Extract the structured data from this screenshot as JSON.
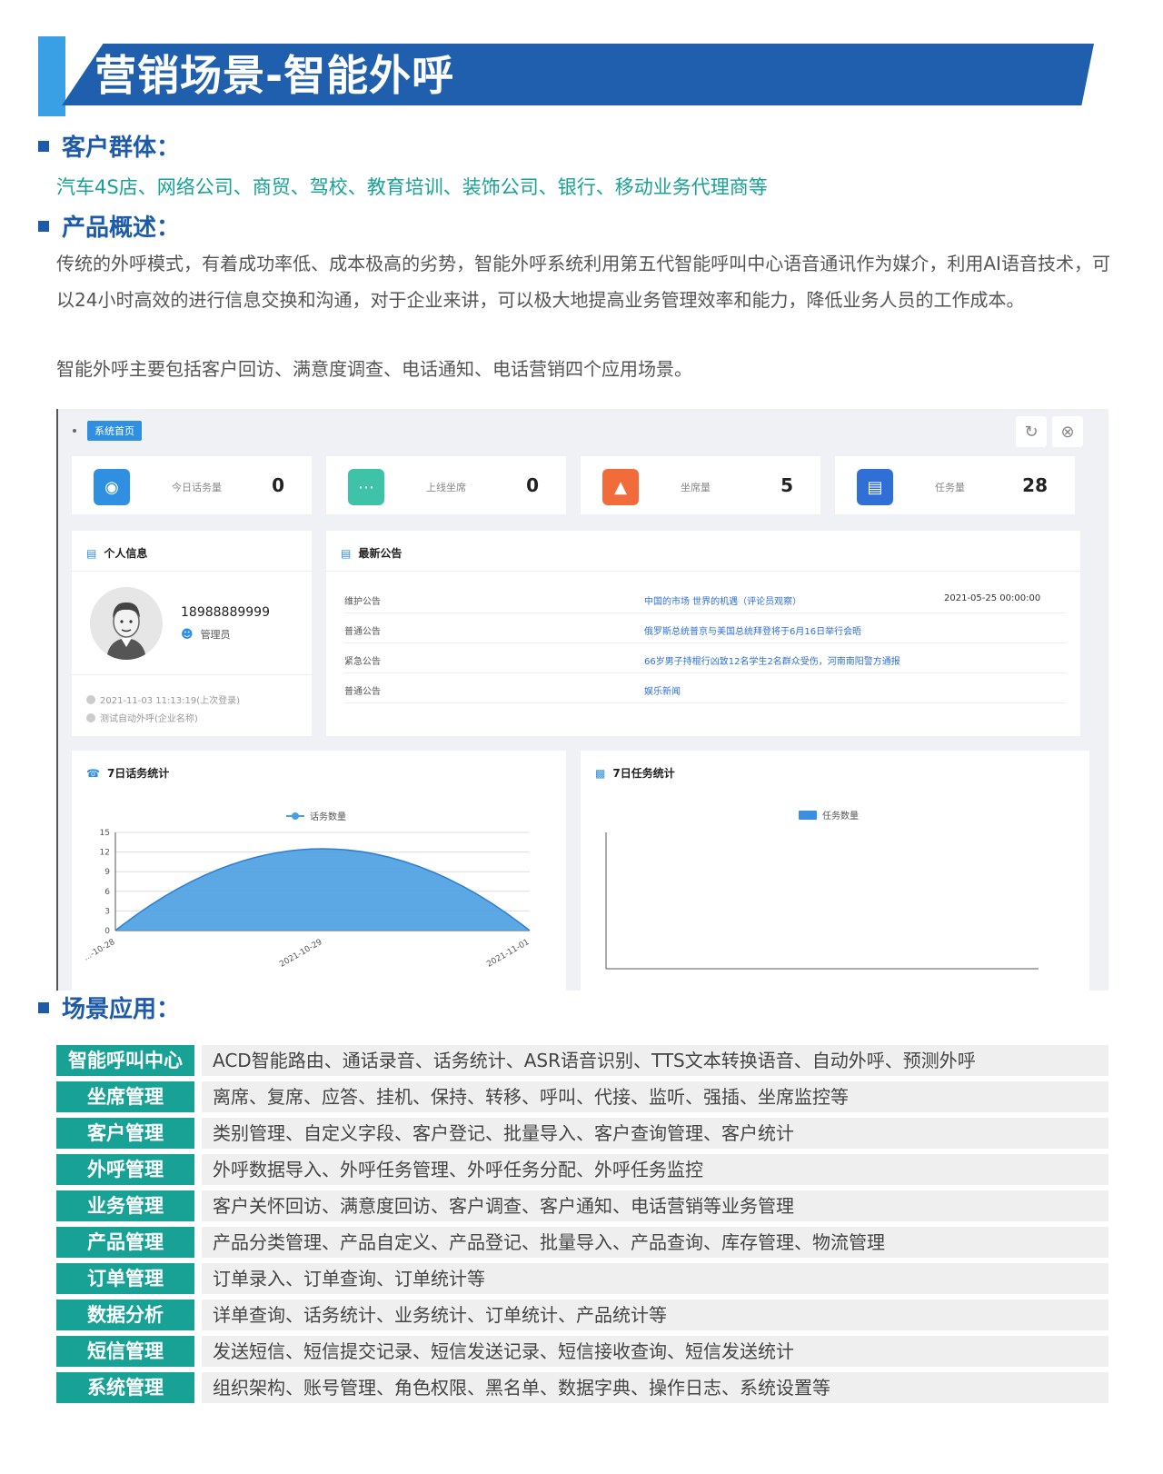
{
  "banner": {
    "title": "营销场景-智能外呼"
  },
  "customers": {
    "heading": "客户群体：",
    "text": "汽车4S店、网络公司、商贸、驾校、教育培训、装饰公司、银行、移动业务代理商等"
  },
  "overview": {
    "heading": "产品概述：",
    "paragraph1": "传统的外呼模式，有着成功率低、成本极高的劣势，智能外呼系统利用第五代智能呼叫中心语音通讯作为媒介，利用AI语音技术，可以24小时高效的进行信息交换和沟通，对于企业来讲，可以极大地提高业务管理效率和能力，降低业务人员的工作成本。",
    "paragraph2": "智能外呼主要包括客户回访、满意度调查、电话通知、电话营销四个应用场景。"
  },
  "dashboard": {
    "tab_label": "系统首页",
    "stats": [
      {
        "label": "今日话务量",
        "value": "0",
        "color": "#2f8fe0",
        "icon": "eye-icon"
      },
      {
        "label": "上线坐席",
        "value": "0",
        "color": "#3fc3a8",
        "icon": "chat-icon"
      },
      {
        "label": "坐席量",
        "value": "5",
        "color": "#f26b3a",
        "icon": "chart-icon"
      },
      {
        "label": "任务量",
        "value": "28",
        "color": "#2f6fd6",
        "icon": "clipboard-icon"
      }
    ],
    "profile": {
      "title": "个人信息",
      "phone": "18988889999",
      "role": "管理员",
      "last_login": "2021-11-03 11:13:19(上次登录)",
      "company": "测试自动外呼(企业名称)"
    },
    "notices": {
      "title": "最新公告",
      "rows": [
        {
          "type": "维护公告",
          "text": "中国的市场 世界的机遇（评论员观察）",
          "date": "2021-05-25 00:00:00"
        },
        {
          "type": "普通公告",
          "text": "俄罗斯总统普京与美国总统拜登将于6月16日举行会晤",
          "date": ""
        },
        {
          "type": "紧急公告",
          "text": "66岁男子持棍行凶致12名学生2名群众受伤，河南南阳警方通报",
          "date": ""
        },
        {
          "type": "普通公告",
          "text": "娱乐新闻",
          "date": ""
        }
      ]
    },
    "call_chart_title": "7日话务统计",
    "task_chart_title": "7日任务统计"
  },
  "chart_data": [
    {
      "type": "area",
      "title": "7日话务统计",
      "series": [
        {
          "name": "话务数量",
          "x": [
            "2021-10-28",
            "2021-10-29",
            "2021-11-01"
          ],
          "values": [
            0,
            12.5,
            0
          ]
        }
      ],
      "x_tick_labels": [
        "...-10-28",
        "2021-10-29",
        "2021-11-01"
      ],
      "y_ticks": [
        0,
        3,
        6,
        9,
        12,
        15
      ],
      "ylim": [
        0,
        15
      ],
      "grid": true,
      "legend": "top-center",
      "color": "#4a9fe2"
    },
    {
      "type": "bar",
      "title": "7日任务统计",
      "series": [
        {
          "name": "任务数量",
          "values": []
        }
      ],
      "legend": "top-center",
      "color": "#3a8fe0"
    }
  ],
  "scenes": {
    "heading": "场景应用：",
    "rows": [
      {
        "name": "智能呼叫中心",
        "desc": "ACD智能路由、通话录音、话务统计、ASR语音识别、TTS文本转换语音、自动外呼、预测外呼"
      },
      {
        "name": "坐席管理",
        "desc": "离席、复席、应答、挂机、保持、转移、呼叫、代接、监听、强插、坐席监控等"
      },
      {
        "name": "客户管理",
        "desc": "类别管理、自定义字段、客户登记、批量导入、客户查询管理、客户统计"
      },
      {
        "name": "外呼管理",
        "desc": "外呼数据导入、外呼任务管理、外呼任务分配、外呼任务监控"
      },
      {
        "name": "业务管理",
        "desc": "客户关怀回访、满意度回访、客户调查、客户通知、电话营销等业务管理"
      },
      {
        "name": "产品管理",
        "desc": "产品分类管理、产品自定义、产品登记、批量导入、产品查询、库存管理、物流管理"
      },
      {
        "name": "订单管理",
        "desc": "订单录入、订单查询、订单统计等"
      },
      {
        "name": "数据分析",
        "desc": "详单查询、话务统计、业务统计、订单统计、产品统计等"
      },
      {
        "name": "短信管理",
        "desc": "发送短信、短信提交记录、短信发送记录、短信接收查询、短信发送统计"
      },
      {
        "name": "系统管理",
        "desc": "组织架构、账号管理、角色权限、黑名单、数据字典、操作日志、系统设置等"
      }
    ]
  }
}
